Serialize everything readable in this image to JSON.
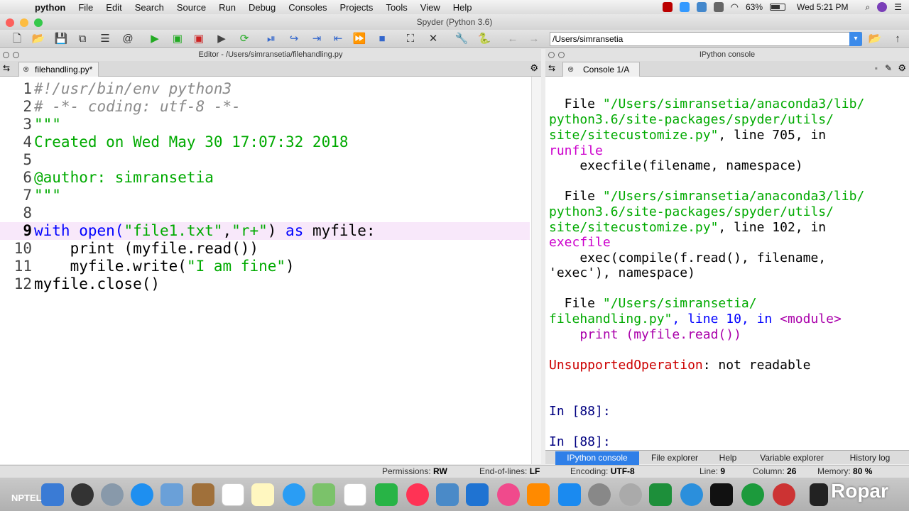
{
  "menubar": {
    "app": "python",
    "items": [
      "File",
      "Edit",
      "Search",
      "Source",
      "Run",
      "Debug",
      "Consoles",
      "Projects",
      "Tools",
      "View",
      "Help"
    ],
    "battery": "63%",
    "clock": "Wed 5:21 PM"
  },
  "window": {
    "title": "Spyder (Python 3.6)"
  },
  "toolbar": {
    "path": "/Users/simransetia"
  },
  "editor": {
    "pane_title": "Editor - /Users/simransetia/filehandling.py",
    "tab_label": "filehandling.py*",
    "lines": [
      {
        "n": "1",
        "text": "#!/usr/bin/env python3"
      },
      {
        "n": "2",
        "text": "# -*- coding: utf-8 -*-"
      },
      {
        "n": "3",
        "text": "\"\"\""
      },
      {
        "n": "4",
        "text": "Created on Wed May 30 17:07:32 2018"
      },
      {
        "n": "5",
        "text": ""
      },
      {
        "n": "6",
        "text": "@author: simransetia"
      },
      {
        "n": "7",
        "text": "\"\"\""
      },
      {
        "n": "8",
        "text": ""
      },
      {
        "n": "9",
        "kw1": "with",
        "fn": " open(",
        "s1": "\"file1.txt\"",
        "comma": ",",
        "s2": "\"r+\"",
        "close": ") ",
        "kw2": "as",
        "rest": " myfile:"
      },
      {
        "n": "10",
        "pre": "    print (myfile.read())"
      },
      {
        "n": "11",
        "pre": "    myfile.write(",
        "s": "\"I am fine\"",
        "post": ")"
      },
      {
        "n": "12",
        "pre": "myfile.close()"
      }
    ]
  },
  "console": {
    "pane_title": "IPython console",
    "tab_label": "Console 1/A",
    "tb1_file": "  File ",
    "tb1_path1": "\"/Users/simransetia/anaconda3/lib/",
    "tb1_path2": "python3.6/site-packages/spyder/utils/",
    "tb1_path3": "site/sitecustomize.py\"",
    "tb1_line": ", line 705, in",
    "tb1_fn": "runfile",
    "tb1_code": "    execfile(filename, namespace)",
    "tb2_file": "  File ",
    "tb2_path1": "\"/Users/simransetia/anaconda3/lib/",
    "tb2_path2": "python3.6/site-packages/spyder/utils/",
    "tb2_path3": "site/sitecustomize.py\"",
    "tb2_line": ", line 102, in",
    "tb2_fn": "execfile",
    "tb2_code1": "    exec(compile(f.read(), filename,",
    "tb2_code2": "'exec'), namespace)",
    "tb3_file": "  File ",
    "tb3_path1": "\"/Users/simransetia/",
    "tb3_path2": "filehandling.py\"",
    "tb3_line": ", line 10, in ",
    "tb3_mod": "<module>",
    "tb3_code": "    print (myfile.read())",
    "err_type": "UnsupportedOperation",
    "err_msg": ": not readable",
    "prompt1": "In [88]:",
    "prompt2": "In [88]:"
  },
  "console_tabs": [
    "IPython console",
    "File explorer",
    "Help",
    "Variable explorer",
    "History log"
  ],
  "status": {
    "permissions_label": "Permissions:",
    "permissions": "RW",
    "eol_label": "End-of-lines:",
    "eol": "LF",
    "encoding_label": "Encoding:",
    "encoding": "UTF-8",
    "line_label": "Line:",
    "line": "9",
    "column_label": "Column:",
    "column": "26",
    "memory_label": "Memory:",
    "memory": "80 %"
  },
  "watermarks": {
    "left": "NPTEL",
    "right": "Ropar"
  },
  "colors": {
    "accent": "#2f7fe8",
    "green_text": "#00aa00",
    "keyword": "#0000ff",
    "error": "#cc0000"
  }
}
